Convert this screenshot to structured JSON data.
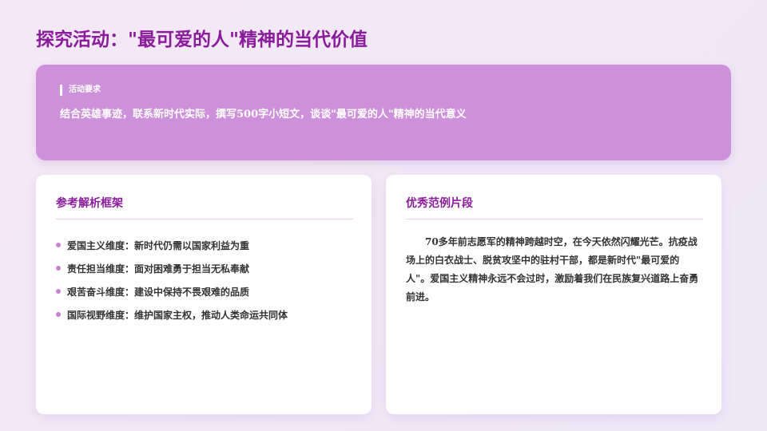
{
  "page": {
    "title": "探究活动：\"最可爱的人\"精神的当代价值"
  },
  "requirement": {
    "label": "活动要求",
    "text": "结合英雄事迹，联系新时代实际，撰写500字小短文，谈谈\"最可爱的人\"精神的当代意义"
  },
  "framework": {
    "title": "参考解析框架",
    "items": [
      {
        "label": "爱国主义维度：新时代仍需以国家利益为重"
      },
      {
        "label": "责任担当维度：面对困难勇于担当无私奉献"
      },
      {
        "label": "艰苦奋斗维度：建设中保持不畏艰难的品质"
      },
      {
        "label": "国际视野维度：维护国家主权，推动人类命运共同体"
      }
    ]
  },
  "example": {
    "title": "优秀范例片段",
    "text": "70多年前志愿军的精神跨越时空，在今天依然闪耀光芒。抗疫战场上的白衣战士、脱贫攻坚中的驻村干部，都是新时代\"最可爱的人\"。爱国主义精神永远不会过时，激励着我们在民族复兴道路上奋勇前进。"
  },
  "colors": {
    "accent": "#8a1c9c",
    "requirement_bg": "#cd90da",
    "bullet": "#c87fd4",
    "page_bg": "#f3e8f5"
  }
}
